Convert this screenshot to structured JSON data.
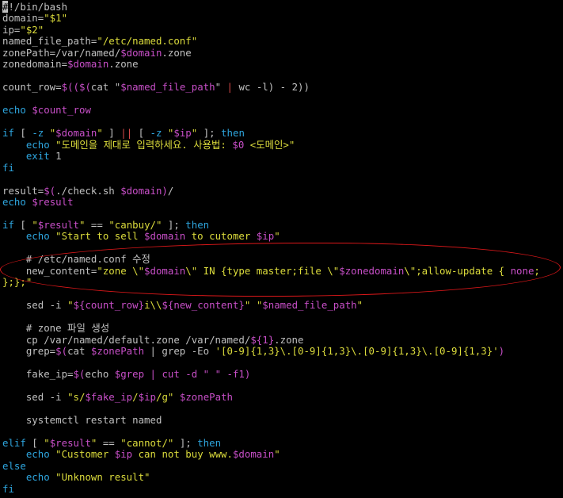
{
  "colors": {
    "background": "#000000",
    "default_text": "#c0c0c0",
    "keyword": "#2ea6df",
    "string": "#dcdc3c",
    "variable": "#c84fc8",
    "redirect": "#d44848",
    "comment": "#8fc7a8",
    "annotation_ring": "#e0181a"
  },
  "lines": [
    [
      {
        "t": "#",
        "c": "cursor"
      },
      {
        "t": "!/bin/bash",
        "c": "c-w"
      }
    ],
    [
      {
        "t": "domain=",
        "c": "c-w"
      },
      {
        "t": "\"$1\"",
        "c": "c-y"
      }
    ],
    [
      {
        "t": "ip=",
        "c": "c-w"
      },
      {
        "t": "\"$2\"",
        "c": "c-y"
      }
    ],
    [
      {
        "t": "named_file_path=",
        "c": "c-w"
      },
      {
        "t": "\"/etc/named.conf\"",
        "c": "c-y"
      }
    ],
    [
      {
        "t": "zonePath=/var/named/",
        "c": "c-w"
      },
      {
        "t": "$domain",
        "c": "c-m"
      },
      {
        "t": ".zone",
        "c": "c-w"
      }
    ],
    [
      {
        "t": "zonedomain=",
        "c": "c-w"
      },
      {
        "t": "$domain",
        "c": "c-m"
      },
      {
        "t": ".zone",
        "c": "c-w"
      }
    ],
    [],
    [
      {
        "t": "count_row=",
        "c": "c-w"
      },
      {
        "t": "$((",
        "c": "c-m"
      },
      {
        "t": "$(",
        "c": "c-m"
      },
      {
        "t": "cat \"",
        "c": "c-w"
      },
      {
        "t": "$named_file_path",
        "c": "c-m"
      },
      {
        "t": "\" ",
        "c": "c-w"
      },
      {
        "t": "|",
        "c": "c-r"
      },
      {
        "t": " wc -l)",
        "c": "c-w"
      },
      {
        "t": " - 2))",
        "c": "c-w"
      }
    ],
    [],
    [
      {
        "t": "echo ",
        "c": "c-b"
      },
      {
        "t": "$count_row",
        "c": "c-m"
      }
    ],
    [],
    [
      {
        "t": "if",
        "c": "c-b"
      },
      {
        "t": " [ ",
        "c": "c-w"
      },
      {
        "t": "-z",
        "c": "c-b"
      },
      {
        "t": " \"",
        "c": "c-y"
      },
      {
        "t": "$domain",
        "c": "c-m"
      },
      {
        "t": "\"",
        "c": "c-y"
      },
      {
        "t": " ] ",
        "c": "c-w"
      },
      {
        "t": "||",
        "c": "c-r"
      },
      {
        "t": " [ ",
        "c": "c-w"
      },
      {
        "t": "-z",
        "c": "c-b"
      },
      {
        "t": " \"",
        "c": "c-y"
      },
      {
        "t": "$ip",
        "c": "c-m"
      },
      {
        "t": "\"",
        "c": "c-y"
      },
      {
        "t": " ]; ",
        "c": "c-w"
      },
      {
        "t": "then",
        "c": "c-b"
      }
    ],
    [
      {
        "t": "    echo ",
        "c": "c-b"
      },
      {
        "t": "\"도메인을 제대로 입력하세요. 사용법: ",
        "c": "c-y"
      },
      {
        "t": "$0",
        "c": "c-m"
      },
      {
        "t": " <도메인>\"",
        "c": "c-y"
      }
    ],
    [
      {
        "t": "    exit ",
        "c": "c-b"
      },
      {
        "t": "1",
        "c": "c-w"
      }
    ],
    [
      {
        "t": "fi",
        "c": "c-b"
      }
    ],
    [],
    [
      {
        "t": "result=",
        "c": "c-w"
      },
      {
        "t": "$(",
        "c": "c-m"
      },
      {
        "t": "./check.sh ",
        "c": "c-w"
      },
      {
        "t": "$domain",
        "c": "c-m"
      },
      {
        "t": ")",
        "c": "c-m"
      },
      {
        "t": "/",
        "c": "c-w"
      }
    ],
    [
      {
        "t": "echo ",
        "c": "c-b"
      },
      {
        "t": "$result",
        "c": "c-m"
      }
    ],
    [],
    [
      {
        "t": "if",
        "c": "c-b"
      },
      {
        "t": " [ ",
        "c": "c-w"
      },
      {
        "t": "\"",
        "c": "c-y"
      },
      {
        "t": "$result",
        "c": "c-m"
      },
      {
        "t": "\"",
        "c": "c-y"
      },
      {
        "t": " == ",
        "c": "c-w"
      },
      {
        "t": "\"canbuy/\"",
        "c": "c-y"
      },
      {
        "t": " ]; ",
        "c": "c-w"
      },
      {
        "t": "then",
        "c": "c-b"
      }
    ],
    [
      {
        "t": "    echo ",
        "c": "c-b"
      },
      {
        "t": "\"Start to sell ",
        "c": "c-y"
      },
      {
        "t": "$domain",
        "c": "c-m"
      },
      {
        "t": " to cutomer ",
        "c": "c-y"
      },
      {
        "t": "$ip",
        "c": "c-m"
      },
      {
        "t": "\"",
        "c": "c-y"
      }
    ],
    [],
    [
      {
        "t": "    # /etc/named.conf 수정",
        "c": "c-w"
      }
    ],
    [
      {
        "t": "    new_content=",
        "c": "c-w"
      },
      {
        "t": "\"zone \\\"",
        "c": "c-y"
      },
      {
        "t": "$domain",
        "c": "c-m"
      },
      {
        "t": "\\\" IN {type master;file \\\"",
        "c": "c-y"
      },
      {
        "t": "$zonedomain",
        "c": "c-m"
      },
      {
        "t": "\\\";allow-update { ",
        "c": "c-y"
      },
      {
        "t": "none",
        "c": "c-m"
      },
      {
        "t": ";",
        "c": "c-y"
      }
    ],
    [
      {
        "t": "};};\"",
        "c": "c-y"
      }
    ],
    [],
    [
      {
        "t": "    sed -i ",
        "c": "c-w"
      },
      {
        "t": "\"",
        "c": "c-y"
      },
      {
        "t": "${count_row}",
        "c": "c-m"
      },
      {
        "t": "i\\\\",
        "c": "c-y"
      },
      {
        "t": "${new_content}",
        "c": "c-m"
      },
      {
        "t": "\"",
        "c": "c-y"
      },
      {
        "t": " \"",
        "c": "c-y"
      },
      {
        "t": "$named_file_path",
        "c": "c-m"
      },
      {
        "t": "\"",
        "c": "c-y"
      }
    ],
    [],
    [
      {
        "t": "    # zone 파일 생성",
        "c": "c-w"
      }
    ],
    [
      {
        "t": "    cp /var/named/default.zone /var/named/",
        "c": "c-w"
      },
      {
        "t": "${1}",
        "c": "c-m"
      },
      {
        "t": ".zone",
        "c": "c-w"
      }
    ],
    [
      {
        "t": "    grep=",
        "c": "c-w"
      },
      {
        "t": "$(",
        "c": "c-m"
      },
      {
        "t": "cat ",
        "c": "c-w"
      },
      {
        "t": "$zonePath",
        "c": "c-m"
      },
      {
        "t": " | grep -Eo ",
        "c": "c-w"
      },
      {
        "t": "'[0-9]{1,3}\\.[0-9]{1,3}\\.[0-9]{1,3}\\.[0-9]{1,3}'",
        "c": "c-y"
      },
      {
        "t": ")",
        "c": "c-m"
      }
    ],
    [],
    [
      {
        "t": "    fake_ip=",
        "c": "c-w"
      },
      {
        "t": "$(",
        "c": "c-m"
      },
      {
        "t": "echo ",
        "c": "c-w"
      },
      {
        "t": "$grep",
        "c": "c-m"
      },
      {
        "t": " | cut -d \" \" -f1)",
        "c": "c-m"
      }
    ],
    [],
    [
      {
        "t": "    sed -i ",
        "c": "c-w"
      },
      {
        "t": "\"s/",
        "c": "c-y"
      },
      {
        "t": "$fake_ip",
        "c": "c-m"
      },
      {
        "t": "/",
        "c": "c-y"
      },
      {
        "t": "$ip",
        "c": "c-m"
      },
      {
        "t": "/g\"",
        "c": "c-y"
      },
      {
        "t": " ",
        "c": "c-w"
      },
      {
        "t": "$zonePath",
        "c": "c-m"
      }
    ],
    [],
    [
      {
        "t": "    systemctl restart named",
        "c": "c-w"
      }
    ],
    [],
    [
      {
        "t": "elif",
        "c": "c-b"
      },
      {
        "t": " [ ",
        "c": "c-w"
      },
      {
        "t": "\"",
        "c": "c-y"
      },
      {
        "t": "$result",
        "c": "c-m"
      },
      {
        "t": "\"",
        "c": "c-y"
      },
      {
        "t": " == ",
        "c": "c-w"
      },
      {
        "t": "\"cannot/\"",
        "c": "c-y"
      },
      {
        "t": " ]; ",
        "c": "c-w"
      },
      {
        "t": "then",
        "c": "c-b"
      }
    ],
    [
      {
        "t": "    echo ",
        "c": "c-b"
      },
      {
        "t": "\"Customer ",
        "c": "c-y"
      },
      {
        "t": "$ip",
        "c": "c-m"
      },
      {
        "t": " can not buy www.",
        "c": "c-y"
      },
      {
        "t": "$domain",
        "c": "c-m"
      },
      {
        "t": "\"",
        "c": "c-y"
      }
    ],
    [
      {
        "t": "else",
        "c": "c-b"
      }
    ],
    [
      {
        "t": "    echo ",
        "c": "c-b"
      },
      {
        "t": "\"Unknown result\"",
        "c": "c-y"
      }
    ],
    [
      {
        "t": "fi",
        "c": "c-b"
      }
    ]
  ]
}
